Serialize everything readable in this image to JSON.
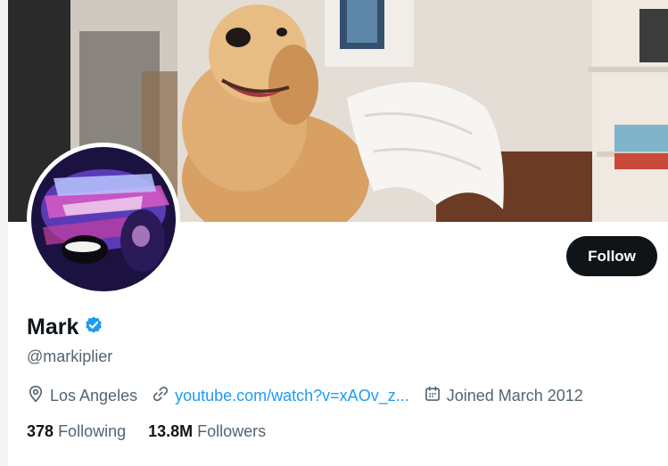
{
  "profile": {
    "name": "Mark",
    "handle": "@markiplier",
    "location": "Los Angeles",
    "website": "youtube.com/watch?v=xAOv_z...",
    "joined": "Joined March 2012",
    "following_count": "378",
    "following_label": "Following",
    "followers_count": "13.8M",
    "followers_label": "Followers"
  },
  "actions": {
    "follow_label": "Follow"
  },
  "colors": {
    "accent": "#1d9bf0",
    "button_bg": "#0f1419",
    "secondary_text": "#536471",
    "verified": "#1d9bf0"
  },
  "icons": [
    "verified-badge-icon",
    "location-pin-icon",
    "link-icon",
    "calendar-icon"
  ]
}
